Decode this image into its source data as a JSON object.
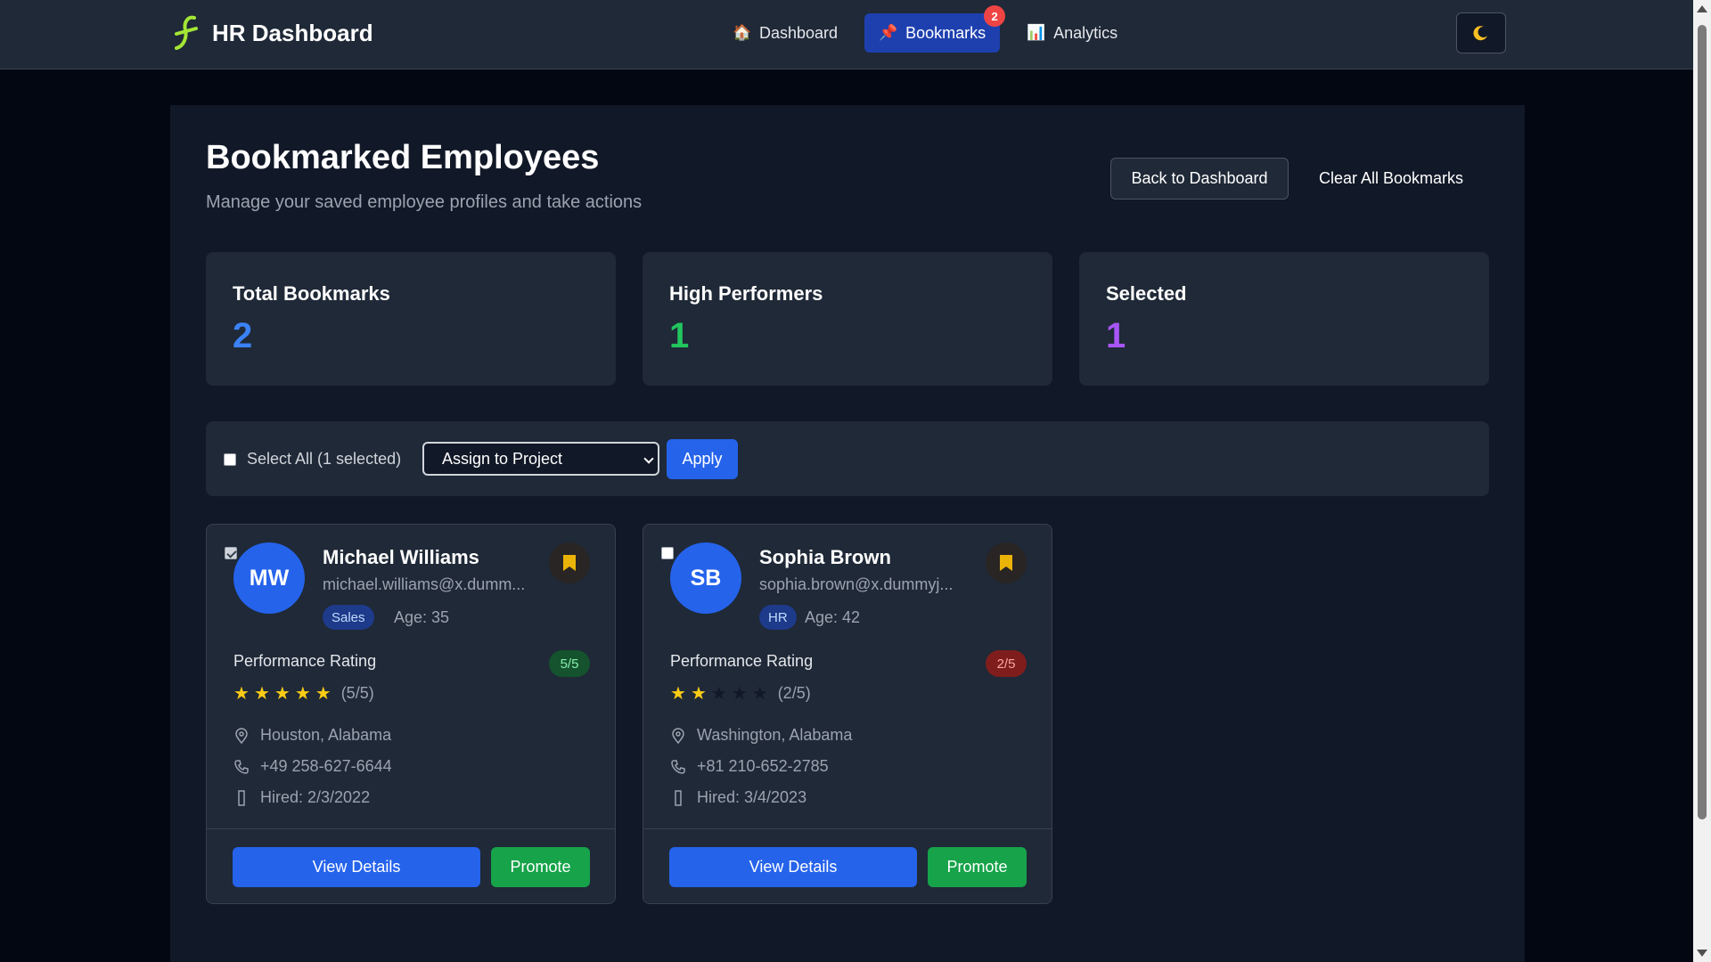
{
  "app": {
    "title": "HR Dashboard"
  },
  "nav": {
    "items": [
      {
        "label": "Dashboard",
        "icon": "house-icon"
      },
      {
        "label": "Bookmarks",
        "icon": "pushpin-icon",
        "badge": "2"
      },
      {
        "label": "Analytics",
        "icon": "bar-chart-icon"
      }
    ],
    "theme_icon": "moon-icon"
  },
  "page": {
    "title": "Bookmarked Employees",
    "subtitle": "Manage your saved employee profiles and take actions",
    "back_button": "Back to Dashboard",
    "clear_button": "Clear All Bookmarks"
  },
  "stats": [
    {
      "label": "Total Bookmarks",
      "value": "2",
      "color": "#3b82f6"
    },
    {
      "label": "High Performers",
      "value": "1",
      "color": "#22c55e"
    },
    {
      "label": "Selected",
      "value": "1",
      "color": "#a855f7"
    }
  ],
  "bulk": {
    "select_all_label": "Select All (1 selected)",
    "action_selected": "Assign to Project",
    "apply_label": "Apply"
  },
  "employees": [
    {
      "initials": "MW",
      "name": "Michael Williams",
      "email": "michael.williams@x.dumm...",
      "department": "Sales",
      "age": "Age: 35",
      "performance_label": "Performance Rating",
      "rating_badge": "5/5",
      "rating": 5,
      "rating_text": "(5/5)",
      "location": "Houston, Alabama",
      "phone": "+49 258-627-6644",
      "hired": "Hired: 2/3/2022",
      "selected": true,
      "view_label": "View Details",
      "promote_label": "Promote"
    },
    {
      "initials": "SB",
      "name": "Sophia Brown",
      "email": "sophia.brown@x.dummyj...",
      "department": "HR",
      "age": "Age: 42",
      "performance_label": "Performance Rating",
      "rating_badge": "2/5",
      "rating": 2,
      "rating_text": "(2/5)",
      "location": "Washington, Alabama",
      "phone": "+81 210-652-2785",
      "hired": "Hired: 3/4/2023",
      "selected": false,
      "view_label": "View Details",
      "promote_label": "Promote"
    }
  ],
  "colors": {
    "accent": "#2563eb",
    "success": "#16a34a",
    "star": "#facc15",
    "bookmark": "#eab308"
  }
}
